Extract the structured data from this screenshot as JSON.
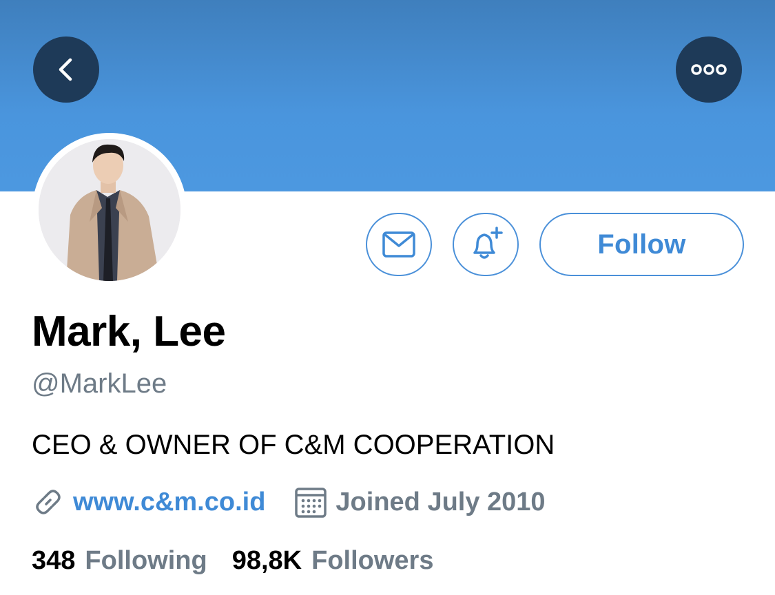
{
  "header": {
    "back_icon": "chevron-left-icon",
    "more_icon": "more-horizontal-icon",
    "banner_color": "#4a95dd",
    "button_bg": "#1e3a58"
  },
  "actions": {
    "message_icon": "mail-icon",
    "notify_icon": "bell-plus-icon",
    "follow_label": "Follow",
    "accent": "#3f8ad6"
  },
  "profile": {
    "name": "Mark, Lee",
    "handle": "@MarkLee",
    "bio": "CEO & OWNER OF C&M COOPERATION",
    "website": "www.c&m.co.id",
    "joined": "Joined July 2010"
  },
  "stats": {
    "following_count": "348",
    "following_label": "Following",
    "followers_count": "98,8K",
    "followers_label": "Followers"
  }
}
